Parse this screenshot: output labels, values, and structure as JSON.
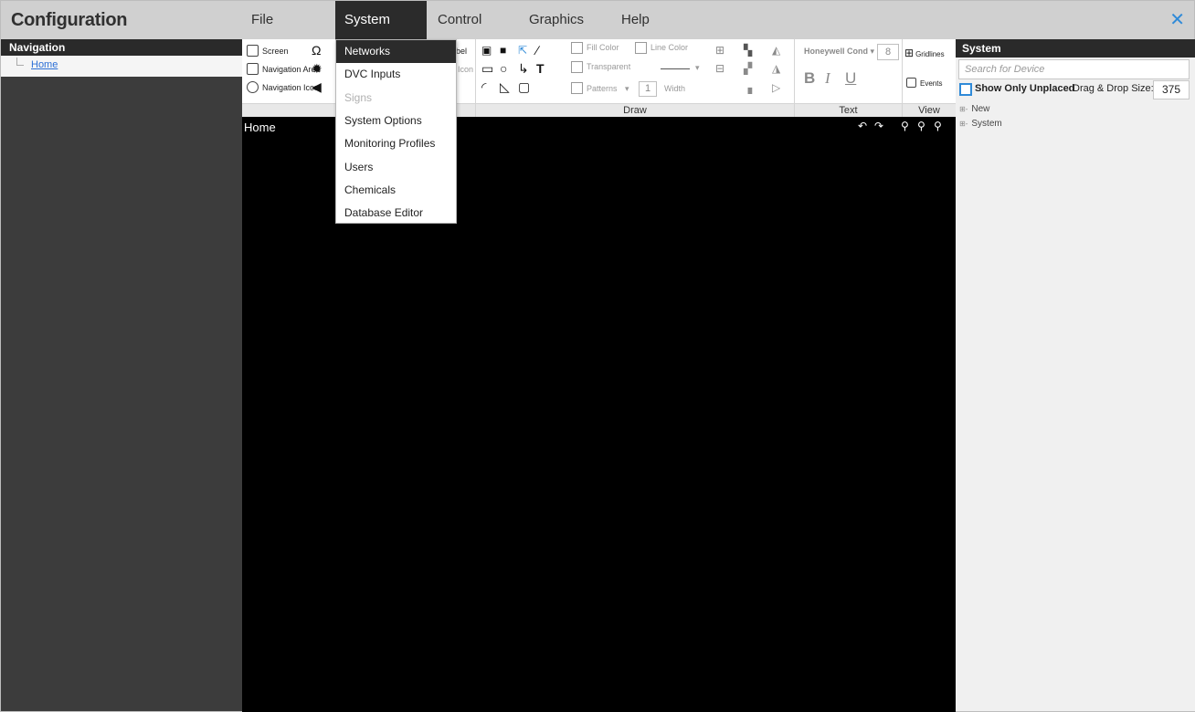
{
  "app": {
    "title": "Configuration"
  },
  "menu": {
    "items": [
      {
        "label": "File"
      },
      {
        "label": "System"
      },
      {
        "label": "Control"
      },
      {
        "label": "Graphics"
      },
      {
        "label": "Help"
      }
    ],
    "active": "System",
    "close_icon": "close-icon",
    "accent_color": "#2f8ad8"
  },
  "navigation": {
    "header": "Navigation",
    "tree": [
      {
        "label": "Home",
        "selected": true
      }
    ]
  },
  "ribbon": {
    "insert": {
      "screen": "Screen",
      "navigation_area": "Navigation Area",
      "navigation_icon": "Navigation Icon",
      "label_partial": "bel",
      "icon_partial": "Icon"
    },
    "draw": {
      "footer": "Draw",
      "fill_color": "Fill Color",
      "transparent": "Transparent",
      "patterns": "Patterns",
      "line_color": "Line Color",
      "width_value": "1",
      "width_label": "Width"
    },
    "text": {
      "footer": "Text",
      "font": "Honeywell Cond",
      "font_size": "8",
      "bold": "B",
      "italic": "I",
      "underline": "U"
    },
    "view": {
      "footer": "View",
      "gridlines": "Gridlines",
      "events": "Events"
    }
  },
  "canvas": {
    "title": "Home",
    "background": "#000000"
  },
  "system_panel": {
    "header": "System",
    "search_placeholder": "Search for Device",
    "show_only_unplaced": "Show Only Unplaced",
    "drag_drop_label": "Drag & Drop Size:",
    "drag_drop_value": "375",
    "tree": [
      {
        "label": "New",
        "expander": "⊞-"
      },
      {
        "label": "System",
        "expander": "⊞-"
      }
    ]
  },
  "system_menu": {
    "items": [
      {
        "label": "Networks",
        "state": "hover"
      },
      {
        "label": "DVC Inputs",
        "state": "normal"
      },
      {
        "label": "Signs",
        "state": "disabled"
      },
      {
        "label": "System Options",
        "state": "normal"
      },
      {
        "label": "Monitoring Profiles",
        "state": "normal"
      },
      {
        "label": "Users",
        "state": "normal"
      },
      {
        "label": "Chemicals",
        "state": "normal"
      },
      {
        "label": "Database Editor",
        "state": "normal"
      }
    ]
  }
}
